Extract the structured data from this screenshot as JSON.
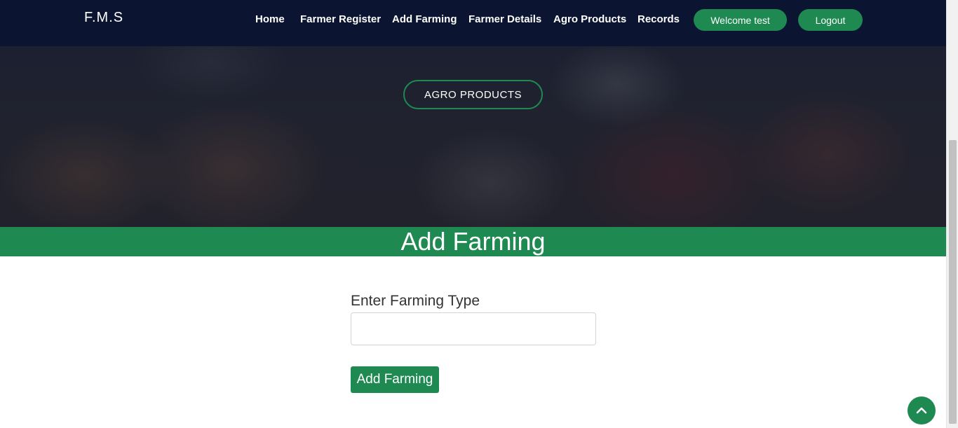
{
  "brand": "F.M.S",
  "nav": {
    "links": [
      "Home",
      "Farmer Register",
      "Add Farming",
      "Farmer Details",
      "Agro Products",
      "Records"
    ],
    "welcome": "Welcome test",
    "logout": "Logout"
  },
  "hero": {
    "button_label": "AGRO PRODUCTS"
  },
  "section": {
    "title": "Add Farming"
  },
  "form": {
    "label": "Enter Farming Type",
    "input_value": "",
    "submit_label": "Add Farming"
  },
  "colors": {
    "accent": "#1e8a52",
    "navbar": "#0b1430"
  },
  "icons": {
    "back_to_top": "chevron-up-icon"
  }
}
